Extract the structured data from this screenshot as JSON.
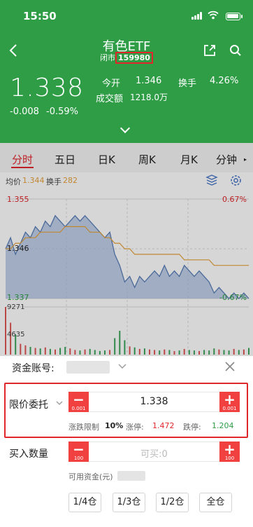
{
  "status_bar": {
    "time": "15:50"
  },
  "header": {
    "title": "有色ETF",
    "exchange": "闭市",
    "code": "159980",
    "price": "1.338",
    "change": "-0.008",
    "change_pct": "-0.59%",
    "stats": {
      "open_label": "今开",
      "open_value": "1.346",
      "turnover_label": "换手",
      "turnover_value": "4.26%",
      "volume_label": "成交额",
      "volume_value": "1218.0万"
    }
  },
  "tabs": [
    "分时",
    "五日",
    "日K",
    "周K",
    "月K",
    "分钟"
  ],
  "chart_info": {
    "avg_label": "均价",
    "avg_value": "1.344",
    "turnover_label": "换手",
    "turnover_value": "282"
  },
  "chart": {
    "high_label": "1.355",
    "high_pct": "0.67%",
    "prev_close_label": "1.346",
    "low_label": "1.337",
    "low_pct": "-0.67%",
    "vol_top": "9271",
    "vol_mid": "4635"
  },
  "chart_data": {
    "type": "line",
    "series": [
      {
        "values": [
          1.346,
          1.348,
          1.345,
          1.347,
          1.349,
          1.348,
          1.35,
          1.349,
          1.351,
          1.35,
          1.352,
          1.351,
          1.35,
          1.351,
          1.352,
          1.351,
          1.352,
          1.351,
          1.35,
          1.349,
          1.348,
          1.349,
          1.345,
          1.343,
          1.34,
          1.341,
          1.339,
          1.341,
          1.34,
          1.341,
          1.342,
          1.341,
          1.343,
          1.341,
          1.342,
          1.341,
          1.343,
          1.342,
          1.341,
          1.342,
          1.341,
          1.34,
          1.338,
          1.339,
          1.338,
          1.337,
          1.338,
          1.337,
          1.338,
          1.337
        ]
      },
      {
        "values": [
          1.346,
          1.346,
          1.347,
          1.347,
          1.348,
          1.348,
          1.348,
          1.349,
          1.349,
          1.349,
          1.349,
          1.349,
          1.35,
          1.35,
          1.35,
          1.35,
          1.35,
          1.349,
          1.349,
          1.349,
          1.348,
          1.348,
          1.347,
          1.347,
          1.346,
          1.346,
          1.345,
          1.345,
          1.345,
          1.345,
          1.345,
          1.345,
          1.345,
          1.345,
          1.345,
          1.345,
          1.344,
          1.344,
          1.344,
          1.344,
          1.344,
          1.344,
          1.343,
          1.343,
          1.343,
          1.343,
          1.343,
          1.343,
          1.343,
          1.343
        ]
      }
    ],
    "ylim": [
      1.337,
      1.355
    ],
    "volumes": [
      9271,
      6200,
      3900,
      2100,
      1800,
      1500,
      1300,
      1200,
      1400,
      1100,
      1000,
      1300,
      1500,
      1200,
      900,
      800,
      1000,
      1100,
      900,
      700,
      800,
      900,
      3200,
      4635,
      2800,
      1600,
      1400,
      1100,
      1200,
      1000,
      900,
      800,
      1000,
      900,
      700,
      800,
      1100,
      900,
      800,
      700,
      900,
      800,
      1200,
      1000,
      900,
      800,
      1100,
      900,
      1000,
      1300
    ]
  },
  "order": {
    "account_label": "资金账号:",
    "order_type": "限价委托",
    "price_value": "1.338",
    "price_step": "0.001",
    "limit_label": "涨跌限制",
    "limit_value": "10%",
    "up_label": "涨停:",
    "up_value": "1.472",
    "down_label": "跌停:",
    "down_value": "1.204",
    "qty_label": "买入数量",
    "qty_placeholder": "可买:0",
    "qty_step": "100",
    "funds_label": "可用资金(元)",
    "quick_buttons": [
      "1/4仓",
      "1/3仓",
      "1/2仓",
      "全仓"
    ]
  },
  "colors": {
    "header_bg": "#2e9d46",
    "accent_red": "#e0262b",
    "price_line": "#5a7fb8",
    "avg_line": "#e6a23c"
  }
}
